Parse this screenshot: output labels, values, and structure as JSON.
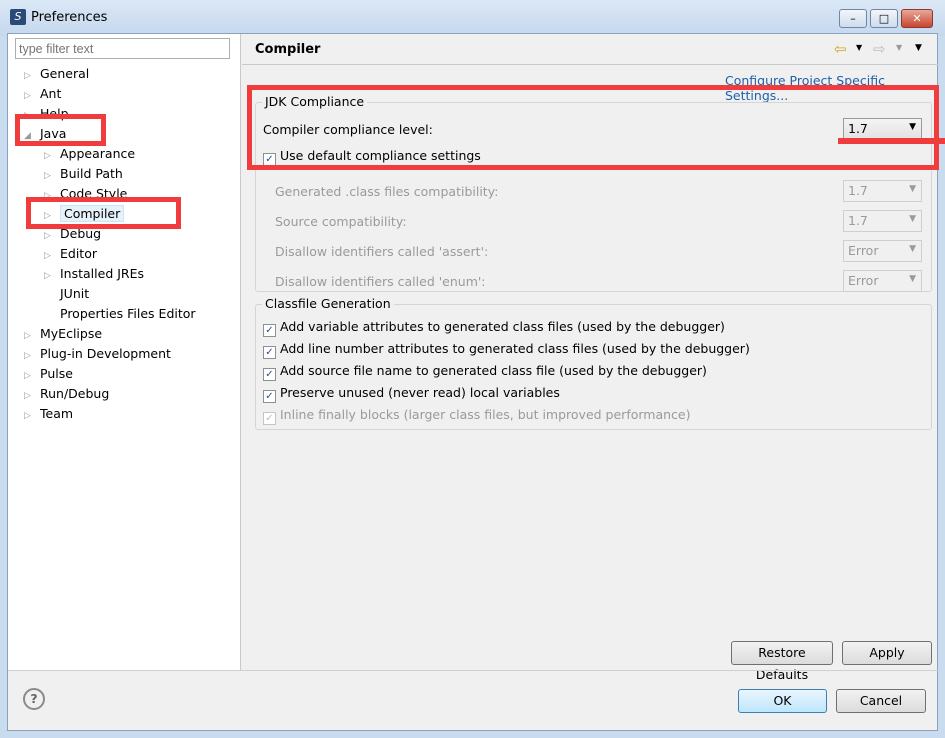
{
  "window": {
    "title": "Preferences",
    "minimize": "–",
    "maximize": "□",
    "close": "✕"
  },
  "filter": {
    "placeholder": "type filter text"
  },
  "tree": [
    {
      "label": "General",
      "level": 0,
      "arrow": "▷"
    },
    {
      "label": "Ant",
      "level": 0,
      "arrow": "▷"
    },
    {
      "label": "Help",
      "level": 0,
      "arrow": "▷"
    },
    {
      "label": "Java",
      "level": 0,
      "arrow": "◢"
    },
    {
      "label": "Appearance",
      "level": 1,
      "arrow": "▷"
    },
    {
      "label": "Build Path",
      "level": 1,
      "arrow": "▷"
    },
    {
      "label": "Code Style",
      "level": 1,
      "arrow": "▷"
    },
    {
      "label": "Compiler",
      "level": 1,
      "arrow": "▷",
      "selected": true
    },
    {
      "label": "Debug",
      "level": 1,
      "arrow": "▷"
    },
    {
      "label": "Editor",
      "level": 1,
      "arrow": "▷"
    },
    {
      "label": "Installed JREs",
      "level": 1,
      "arrow": "▷"
    },
    {
      "label": "JUnit",
      "level": 1,
      "arrow": ""
    },
    {
      "label": "Properties Files Editor",
      "level": 1,
      "arrow": ""
    },
    {
      "label": "MyEclipse",
      "level": 0,
      "arrow": "▷"
    },
    {
      "label": "Plug-in Development",
      "level": 0,
      "arrow": "▷"
    },
    {
      "label": "Pulse",
      "level": 0,
      "arrow": "▷"
    },
    {
      "label": "Run/Debug",
      "level": 0,
      "arrow": "▷"
    },
    {
      "label": "Team",
      "level": 0,
      "arrow": "▷"
    }
  ],
  "page": {
    "title": "Compiler",
    "nav": {
      "back": "⇦",
      "forward": "⇨",
      "dropdown": "▼"
    },
    "configure_link": "Configure Project Specific Settings...",
    "jdk": {
      "title": "JDK Compliance",
      "level_label": "Compiler compliance level:",
      "level_value": "1.7",
      "use_default": "Use default compliance settings",
      "use_default_checked": true,
      "rows": [
        {
          "label": "Generated .class files compatibility:",
          "value": "1.7"
        },
        {
          "label": "Source compatibility:",
          "value": "1.7"
        },
        {
          "label": "Disallow identifiers called 'assert':",
          "value": "Error"
        },
        {
          "label": "Disallow identifiers called 'enum':",
          "value": "Error"
        }
      ]
    },
    "classfile": {
      "title": "Classfile Generation",
      "options": [
        {
          "label": "Add variable attributes to generated class files (used by the debugger)",
          "checked": true,
          "enabled": true
        },
        {
          "label": "Add line number attributes to generated class files (used by the debugger)",
          "checked": true,
          "enabled": true
        },
        {
          "label": "Add source file name to generated class file (used by the debugger)",
          "checked": true,
          "enabled": true
        },
        {
          "label": "Preserve unused (never read) local variables",
          "checked": true,
          "enabled": true
        },
        {
          "label": "Inline finally blocks (larger class files, but improved performance)",
          "checked": true,
          "enabled": false
        }
      ]
    },
    "restore_defaults": "Restore Defaults",
    "apply": "Apply"
  },
  "footer": {
    "help": "?",
    "ok": "OK",
    "cancel": "Cancel"
  },
  "colors": {
    "annotation": "#f03c3c",
    "link": "#1f5fa8"
  }
}
